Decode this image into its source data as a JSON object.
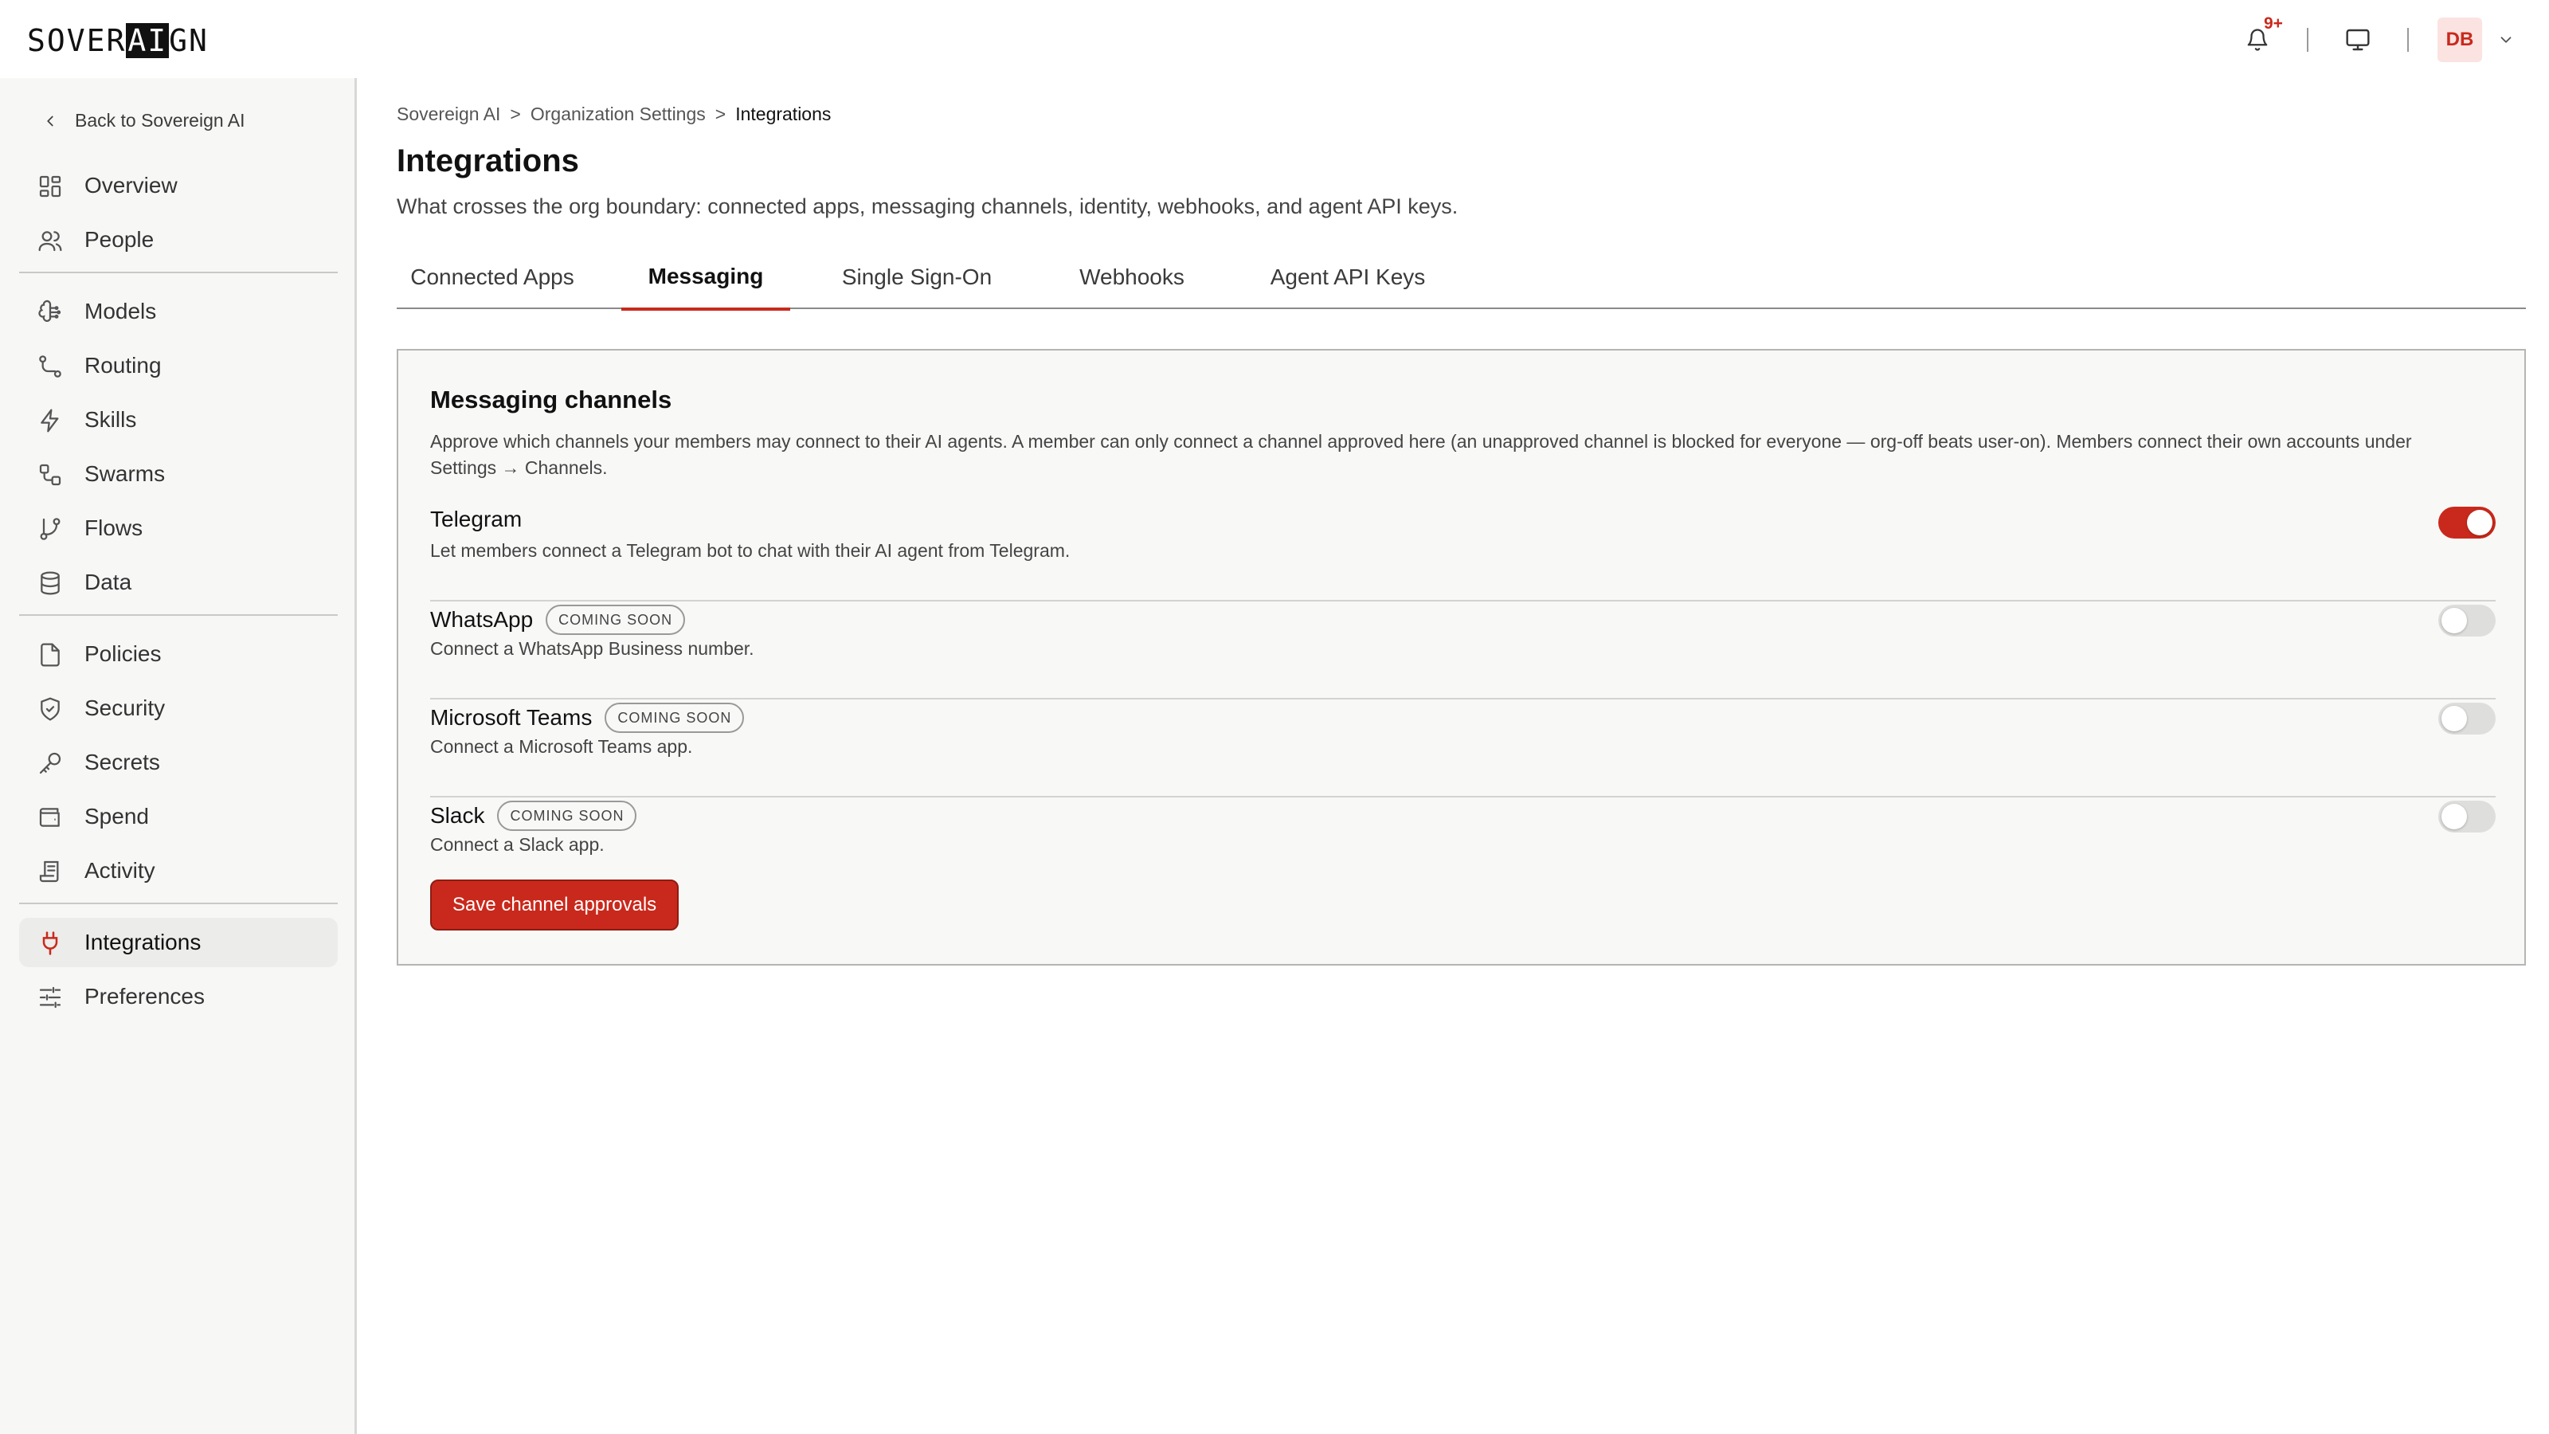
{
  "brand": {
    "prefix": "SOVER",
    "highlight": "AI",
    "suffix": "GN"
  },
  "topbar": {
    "notification_count": "9+",
    "avatar_initials": "DB"
  },
  "sidebar": {
    "back_label": "Back to Sovereign AI",
    "items": [
      {
        "label": "Overview",
        "icon": "grid-icon"
      },
      {
        "label": "People",
        "icon": "people-icon"
      },
      {
        "label": "Models",
        "icon": "brain-icon"
      },
      {
        "label": "Routing",
        "icon": "routing-icon"
      },
      {
        "label": "Skills",
        "icon": "lightning-icon"
      },
      {
        "label": "Swarms",
        "icon": "swarm-icon"
      },
      {
        "label": "Flows",
        "icon": "branch-icon"
      },
      {
        "label": "Data",
        "icon": "database-icon"
      },
      {
        "label": "Policies",
        "icon": "document-icon"
      },
      {
        "label": "Security",
        "icon": "shield-icon"
      },
      {
        "label": "Secrets",
        "icon": "key-icon"
      },
      {
        "label": "Spend",
        "icon": "wallet-icon"
      },
      {
        "label": "Activity",
        "icon": "log-icon"
      },
      {
        "label": "Integrations",
        "icon": "plug-icon",
        "active": true
      },
      {
        "label": "Preferences",
        "icon": "sliders-icon"
      }
    ]
  },
  "breadcrumb": {
    "root": "Sovereign AI",
    "sep1": ">",
    "parent": "Organization Settings",
    "sep2": ">",
    "current": "Integrations"
  },
  "page": {
    "title": "Integrations",
    "subtitle": "What crosses the org boundary: connected apps, messaging channels, identity, webhooks, and agent API keys."
  },
  "tabs": [
    {
      "label": "Connected Apps"
    },
    {
      "label": "Messaging",
      "active": true
    },
    {
      "label": "Single Sign-On"
    },
    {
      "label": "Webhooks"
    },
    {
      "label": "Agent API Keys"
    }
  ],
  "messaging": {
    "title": "Messaging channels",
    "description": "Approve which channels your members may connect to their AI agents. A member can only connect a channel approved here (an unapproved channel is blocked for everyone — org-off beats user-on). Members connect their own accounts under Settings → Channels.",
    "channels": [
      {
        "name": "Telegram",
        "description": "Let members connect a Telegram bot to chat with their AI agent from Telegram.",
        "badge": "",
        "enabled": true
      },
      {
        "name": "WhatsApp",
        "description": "Connect a WhatsApp Business number.",
        "badge": "COMING SOON",
        "enabled": false
      },
      {
        "name": "Microsoft Teams",
        "description": "Connect a Microsoft Teams app.",
        "badge": "COMING SOON",
        "enabled": false
      },
      {
        "name": "Slack",
        "description": "Connect a Slack app.",
        "badge": "COMING SOON",
        "enabled": false
      }
    ],
    "save_label": "Save channel approvals"
  },
  "colors": {
    "accent": "#c9291c",
    "sidebar_bg": "#f7f7f6",
    "card_bg": "#f8f8f7"
  }
}
